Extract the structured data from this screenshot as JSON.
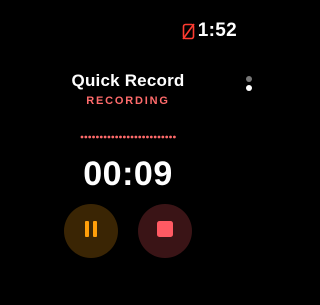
{
  "status_bar": {
    "time": "1:52",
    "icon": "phone-disconnected-icon",
    "icon_color": "#ff3b30"
  },
  "recorder": {
    "title": "Quick Record",
    "state": "RECORDING",
    "elapsed": "00:09",
    "accent_color": "#ff6b6b"
  },
  "page_indicator": {
    "count": 2,
    "active": 1
  },
  "controls": {
    "pause_icon": "pause-icon",
    "pause_color": "#ff9f0a",
    "stop_icon": "stop-icon",
    "stop_color": "#ff5a63"
  }
}
